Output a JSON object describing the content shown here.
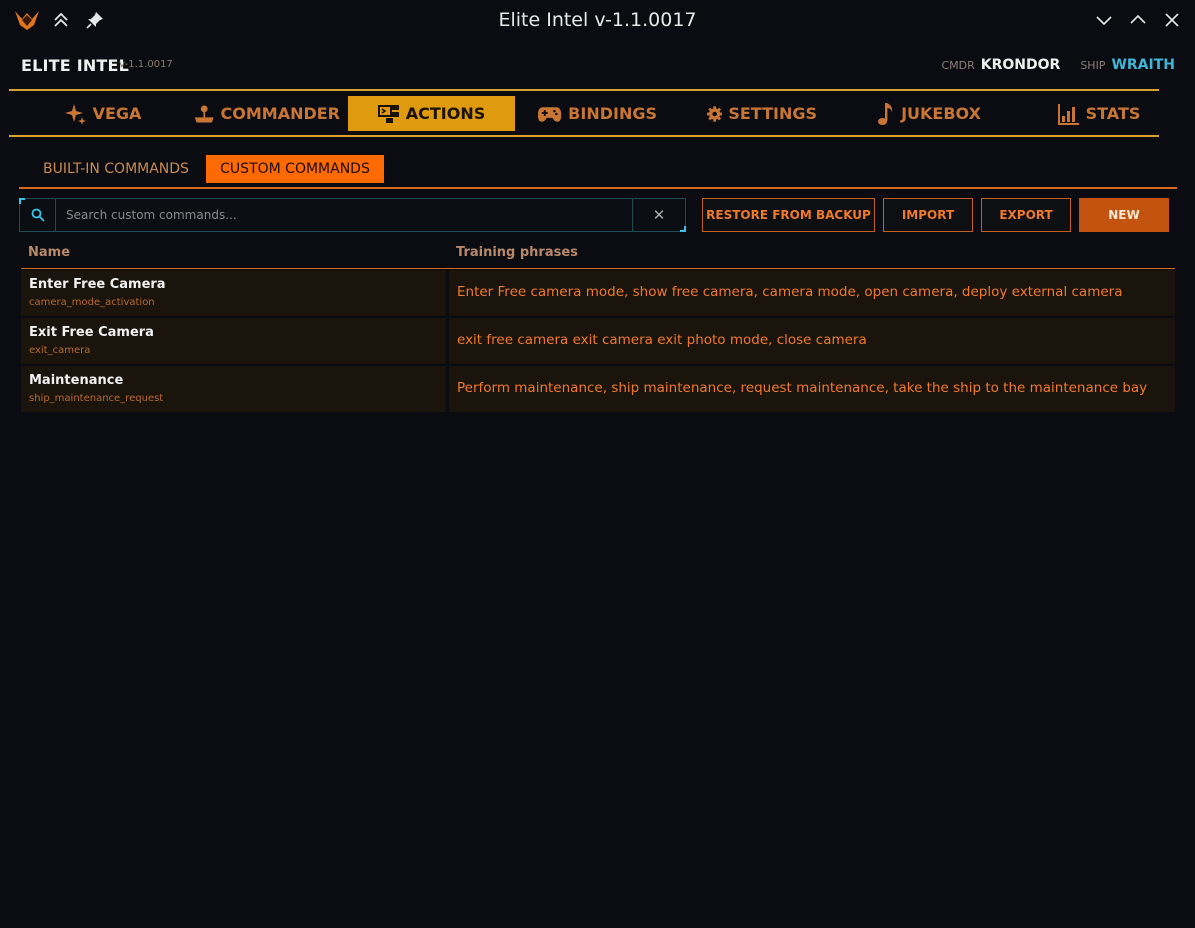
{
  "window": {
    "title": "Elite Intel v-1.1.0017"
  },
  "header": {
    "brand": "ELITE INTEL",
    "version": "v-1.1.0017",
    "cmdr_label": "CMDR",
    "cmdr_name": "KRONDOR",
    "ship_label": "SHIP",
    "ship_name": "WRAITH"
  },
  "nav": {
    "tabs": [
      {
        "label": "VEGA",
        "icon": "sparkle-icon"
      },
      {
        "label": "COMMANDER",
        "icon": "joystick-icon"
      },
      {
        "label": "ACTIONS",
        "icon": "commands-icon",
        "active": true
      },
      {
        "label": "BINDINGS",
        "icon": "gamepad-icon"
      },
      {
        "label": "SETTINGS",
        "icon": "gear-icon"
      },
      {
        "label": "JUKEBOX",
        "icon": "music-note-icon"
      },
      {
        "label": "STATS",
        "icon": "bar-chart-icon"
      }
    ]
  },
  "subtabs": [
    {
      "label": "BUILT-IN COMMANDS"
    },
    {
      "label": "CUSTOM COMMANDS",
      "active": true
    }
  ],
  "search": {
    "placeholder": "Search custom commands...",
    "value": ""
  },
  "buttons": {
    "restore": "RESTORE FROM BACKUP",
    "import": "IMPORT",
    "export": "EXPORT",
    "new": "NEW"
  },
  "table": {
    "columns": [
      "Name",
      "Training phrases"
    ],
    "rows": [
      {
        "name": "Enter Free Camera",
        "id": "camera_mode_activation",
        "phrases": "Enter Free camera mode, show free camera, camera mode, open camera, deploy external camera"
      },
      {
        "name": "Exit Free Camera",
        "id": "exit_camera",
        "phrases": "exit free camera exit camera exit photo mode, close camera"
      },
      {
        "name": "Maintenance",
        "id": "ship_maintenance_request",
        "phrases": "Perform maintenance, ship maintenance, request maintenance, take the ship to the maintenance bay"
      }
    ]
  },
  "colors": {
    "accent_orange": "#ff6a00",
    "active_tab": "#e09a0d",
    "ship_cyan": "#3fb6d6",
    "background": "#0a0c11"
  }
}
